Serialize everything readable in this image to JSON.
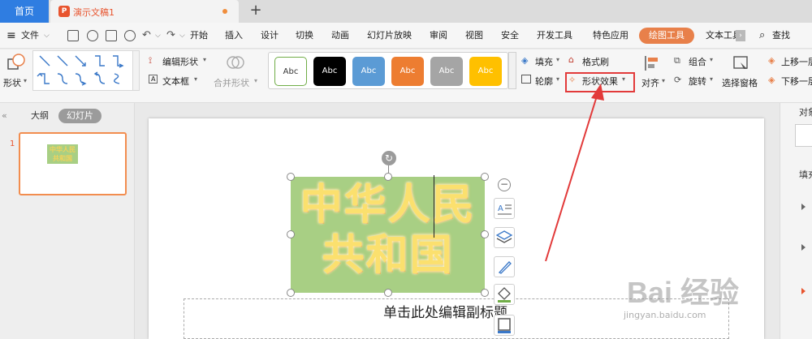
{
  "titlebar": {
    "home_tab": "首页",
    "doc_tab": "演示文稿1",
    "logo_letter": "P"
  },
  "menu": {
    "file": "文件",
    "items": [
      "开始",
      "插入",
      "设计",
      "切换",
      "动画",
      "幻灯片放映",
      "审阅",
      "视图",
      "安全",
      "开发工具",
      "特色应用"
    ],
    "drawing_tools": "绘图工具",
    "text_tools": "文本工具",
    "search": "查找"
  },
  "ribbon": {
    "shape": "形状",
    "edit_shape": "编辑形状",
    "text_box": "文本框",
    "merge_shape": "合并形状",
    "style_label": "Abc",
    "style_colors": [
      "#ffffff",
      "#000000",
      "#5b9bd5",
      "#ed7d31",
      "#a5a5a5",
      "#ffc000"
    ],
    "fill": "填充",
    "format_brush": "格式刷",
    "outline": "轮廓",
    "shape_effects": "形状效果",
    "align": "对齐",
    "group": "组合",
    "rotate": "旋转",
    "selection_pane": "选择窗格",
    "bring_forward": "上移一层",
    "send_backward": "下移一层"
  },
  "left_pane": {
    "outline_tab": "大纲",
    "slides_tab": "幻灯片",
    "slide_number": "1",
    "thumb_text": "中华人民共和国"
  },
  "slide": {
    "title_line1": "中华人民",
    "title_line2": "共和国",
    "subtitle_placeholder": "单击此处编辑副标题"
  },
  "right_pane": {
    "object_label": "对象",
    "fill_label": "填充"
  },
  "watermark": {
    "main": "Bai 经验",
    "sub": "jingyan.baidu.com"
  },
  "colors": {
    "accent_blue": "#2f7de1",
    "accent_orange": "#e8804a",
    "highlight_red": "#e23a3a",
    "shape_green": "#a8cf84",
    "text_yellow": "#fbe06e"
  }
}
